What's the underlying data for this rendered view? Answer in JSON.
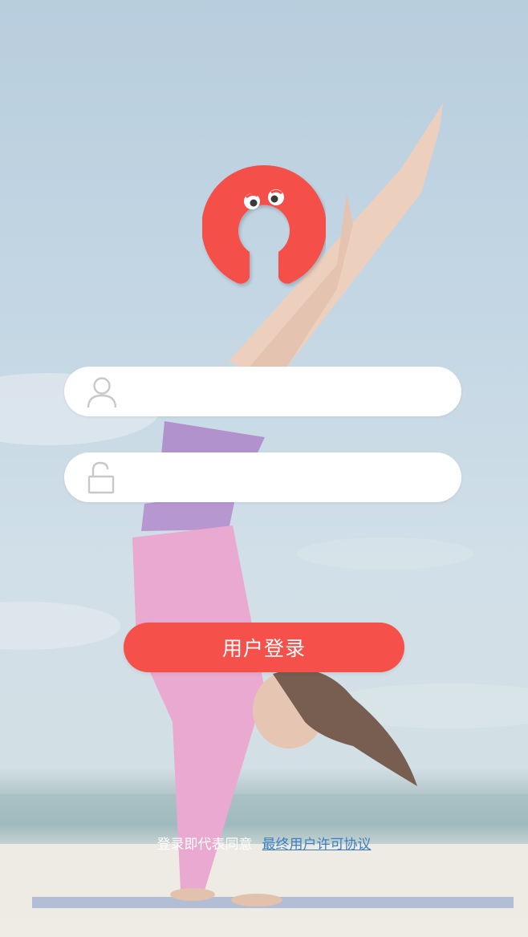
{
  "login": {
    "username": {
      "icon": "user-icon",
      "value": "",
      "placeholder": ""
    },
    "password": {
      "icon": "unlock-icon",
      "value": "",
      "placeholder": ""
    },
    "login_button_label": "用户登录"
  },
  "agreement": {
    "prefix": "登录即代表同意",
    "link": "最终用户许可协议"
  },
  "colors": {
    "accent": "#f55049",
    "link": "#3a7fc0",
    "icon_gray": "#c8c8c8"
  }
}
